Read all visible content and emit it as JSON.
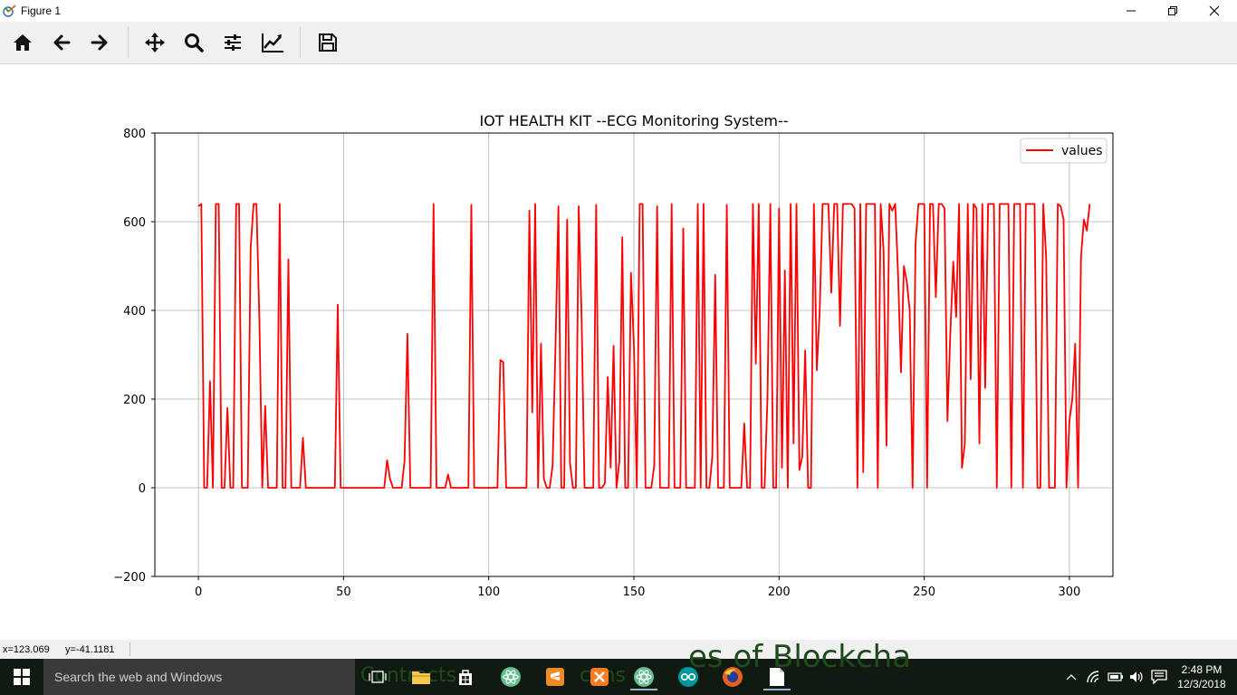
{
  "window": {
    "title": "Figure 1"
  },
  "toolbar": {
    "buttons": [
      "home-icon",
      "back-arrow-icon",
      "forward-arrow-icon",
      "pan-icon",
      "zoom-icon",
      "configure-subplots-icon",
      "edit-axis-icon",
      "save-icon"
    ]
  },
  "status": {
    "x": "x=123.069",
    "y": "y=-41.1181"
  },
  "taskbar": {
    "search_placeholder": "Search the web and Windows",
    "time": "2:48 PM",
    "date": "12/3/2018",
    "background_text": [
      "es of Blockcha",
      "Contracts",
      "cons"
    ]
  },
  "colors": {
    "line": "#ff0000",
    "grid": "#b0b0b0",
    "taskbar": "#101a10"
  },
  "chart_data": {
    "type": "line",
    "title": "IOT HEALTH KIT --ECG Monitoring System--",
    "xlabel": "",
    "ylabel": "",
    "xlim": [
      -15,
      315
    ],
    "ylim": [
      -200,
      800
    ],
    "xticks": [
      0,
      50,
      100,
      150,
      200,
      250,
      300
    ],
    "xtick_labels": [
      "0",
      "50",
      "100",
      "150",
      "200",
      "250",
      "300"
    ],
    "yticks": [
      -200,
      0,
      200,
      400,
      600,
      800
    ],
    "ytick_labels": [
      "−200",
      "0",
      "200",
      "400",
      "600",
      "800"
    ],
    "grid": true,
    "legend": "top-right",
    "series": [
      {
        "name": "values",
        "color": "#ff0000",
        "values": [
          635,
          640,
          0,
          0,
          240,
          0,
          640,
          640,
          0,
          0,
          180,
          0,
          0,
          640,
          640,
          0,
          0,
          0,
          540,
          640,
          640,
          380,
          0,
          185,
          0,
          0,
          0,
          0,
          640,
          0,
          0,
          515,
          0,
          0,
          0,
          0,
          113,
          0,
          0,
          0,
          0,
          0,
          0,
          0,
          0,
          0,
          0,
          0,
          413,
          0,
          0,
          0,
          0,
          0,
          0,
          0,
          0,
          0,
          0,
          0,
          0,
          0,
          0,
          0,
          0,
          62,
          20,
          0,
          0,
          0,
          0,
          60,
          347,
          0,
          0,
          0,
          0,
          0,
          0,
          0,
          0,
          640,
          0,
          0,
          0,
          0,
          30,
          0,
          0,
          0,
          0,
          0,
          0,
          0,
          638,
          0,
          0,
          0,
          0,
          0,
          0,
          0,
          0,
          0,
          288,
          283,
          0,
          0,
          0,
          0,
          0,
          0,
          0,
          0,
          625,
          170,
          640,
          0,
          325,
          20,
          0,
          0,
          50,
          320,
          635,
          0,
          0,
          605,
          55,
          0,
          0,
          635,
          380,
          0,
          0,
          0,
          0,
          638,
          0,
          0,
          10,
          250,
          45,
          320,
          0,
          60,
          565,
          0,
          0,
          485,
          320,
          0,
          640,
          640,
          0,
          0,
          0,
          50,
          635,
          0,
          0,
          0,
          0,
          640,
          0,
          0,
          0,
          585,
          0,
          0,
          0,
          0,
          640,
          0,
          640,
          0,
          0,
          70,
          480,
          0,
          0,
          0,
          638,
          0,
          0,
          0,
          0,
          0,
          145,
          0,
          0,
          640,
          280,
          640,
          0,
          0,
          200,
          640,
          0,
          0,
          630,
          45,
          490,
          0,
          640,
          100,
          640,
          40,
          70,
          310,
          0,
          0,
          640,
          265,
          400,
          640,
          640,
          640,
          440,
          640,
          640,
          365,
          640,
          640,
          640,
          640,
          630,
          0,
          640,
          35,
          640,
          640,
          640,
          640,
          0,
          640,
          535,
          95,
          640,
          625,
          640,
          480,
          260,
          500,
          465,
          400,
          0,
          550,
          640,
          640,
          640,
          0,
          640,
          640,
          430,
          640,
          640,
          630,
          150,
          350,
          510,
          385,
          640,
          45,
          100,
          640,
          245,
          640,
          630,
          100,
          640,
          225,
          640,
          640,
          640,
          0,
          640,
          640,
          640,
          640,
          0,
          640,
          640,
          640,
          0,
          640,
          640,
          640,
          640,
          0,
          0,
          640,
          520,
          0,
          0,
          0,
          640,
          635,
          605,
          0,
          150,
          200,
          325,
          0,
          520,
          605,
          580,
          640
        ]
      }
    ]
  }
}
